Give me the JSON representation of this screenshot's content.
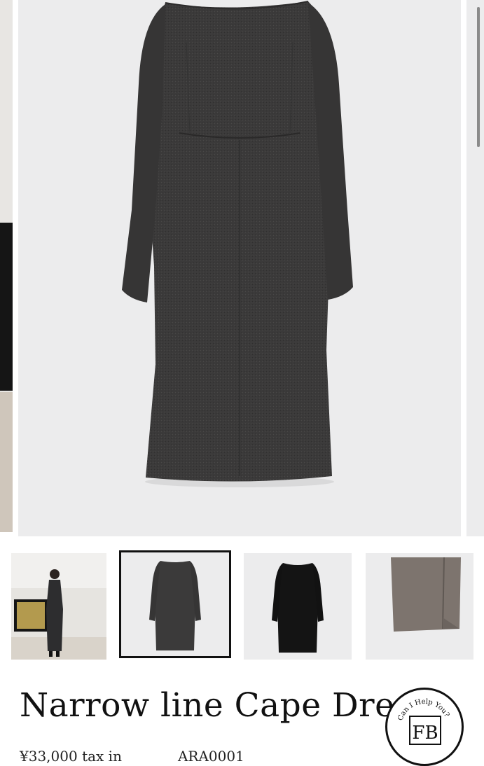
{
  "product": {
    "title": "Narrow line Cape Dress",
    "price": "¥33,000",
    "tax_note": "tax in",
    "sku": "ARA0001"
  },
  "gallery": {
    "main_image_alt": "charcoal grey long-sleeve narrow line dress",
    "thumbnails": [
      {
        "alt": "model wearing dress in living room"
      },
      {
        "alt": "charcoal dress flat lay"
      },
      {
        "alt": "black dress flat lay"
      },
      {
        "alt": "fabric close-up"
      }
    ],
    "selected_index": 1
  },
  "badge": {
    "text": "Can I Help You?",
    "monogram": "FB"
  },
  "colors": {
    "dress_charcoal": "#3b3a3a",
    "dress_black": "#141414",
    "fabric_taupe": "#7d746e",
    "photo_bg": "#ececed"
  }
}
